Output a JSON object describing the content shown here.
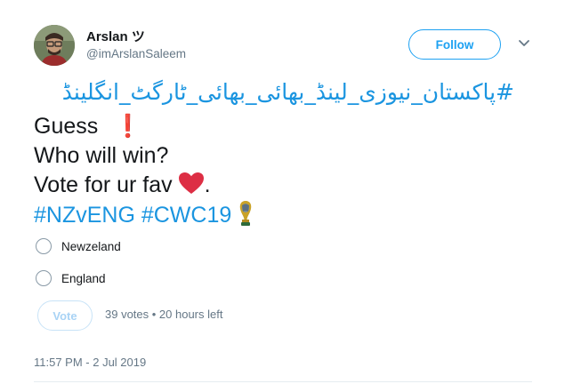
{
  "author": {
    "display_name": "Arslan ツ",
    "username": "@imArslanSaleem"
  },
  "follow_label": "Follow",
  "tweet": {
    "urdu_hashtag": "#پاکستان_نیوزی_لینڈ_بھائی_بھائی_ٹارگٹ_انگلینڈ",
    "line1": "Guess",
    "line1_emoji": "❗",
    "line2": "Who will win?",
    "line3": "Vote for ur fav",
    "line3_suffix": ".",
    "hashtags": "#NZvENG #CWC19"
  },
  "poll": {
    "options": [
      {
        "label": "Newzeland"
      },
      {
        "label": "England"
      }
    ],
    "vote_label": "Vote",
    "meta": "39 votes • 20 hours left"
  },
  "timestamp": "11:57 PM - 2 Jul 2019",
  "colors": {
    "link": "#1da1f2",
    "hashtag": "#1b95e0",
    "muted": "#657786",
    "heart": "#dd2e44"
  }
}
